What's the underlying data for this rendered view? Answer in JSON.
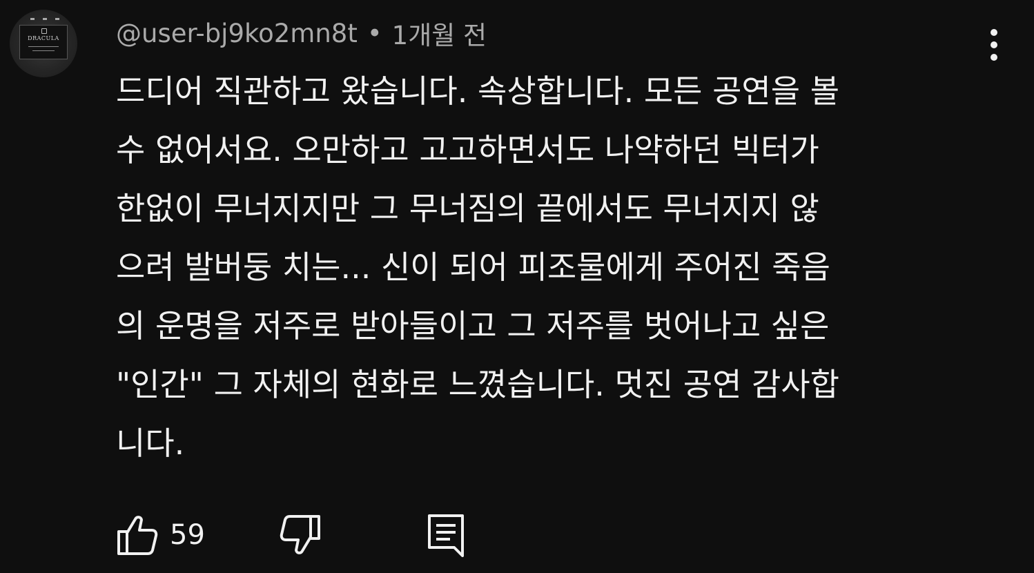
{
  "comment": {
    "author": "@user-bj9ko2mn8t",
    "separator": "•",
    "time": "1개월 전",
    "avatar_icon": "dracula-poster-avatar",
    "avatar_text": "DRACULA",
    "text": "드디어 직관하고 왔습니다. 속상합니다. 모든 공연을 볼\n수 없어서요. 오만하고 고고하면서도 나약하던 빅터가\n한없이 무너지지만 그 무너짐의 끝에서도 무너지지 않\n으려 발버둥 치는... 신이 되어 피조물에게 주어진 죽음\n의 운명을 저주로 받아들이고 그 저주를 벗어나고 싶은\n\"인간\" 그 자체의 현화로 느꼈습니다. 멋진 공연 감사합\n니다.",
    "menu_icon": "more-vertical-icon"
  },
  "actions": {
    "like_icon": "thumbs-up-icon",
    "like_count": "59",
    "dislike_icon": "thumbs-down-icon",
    "reply_icon": "reply-comment-icon"
  },
  "colors": {
    "background": "#0f0f0f",
    "text": "#f1f1f1",
    "meta": "#aaaaaa"
  }
}
